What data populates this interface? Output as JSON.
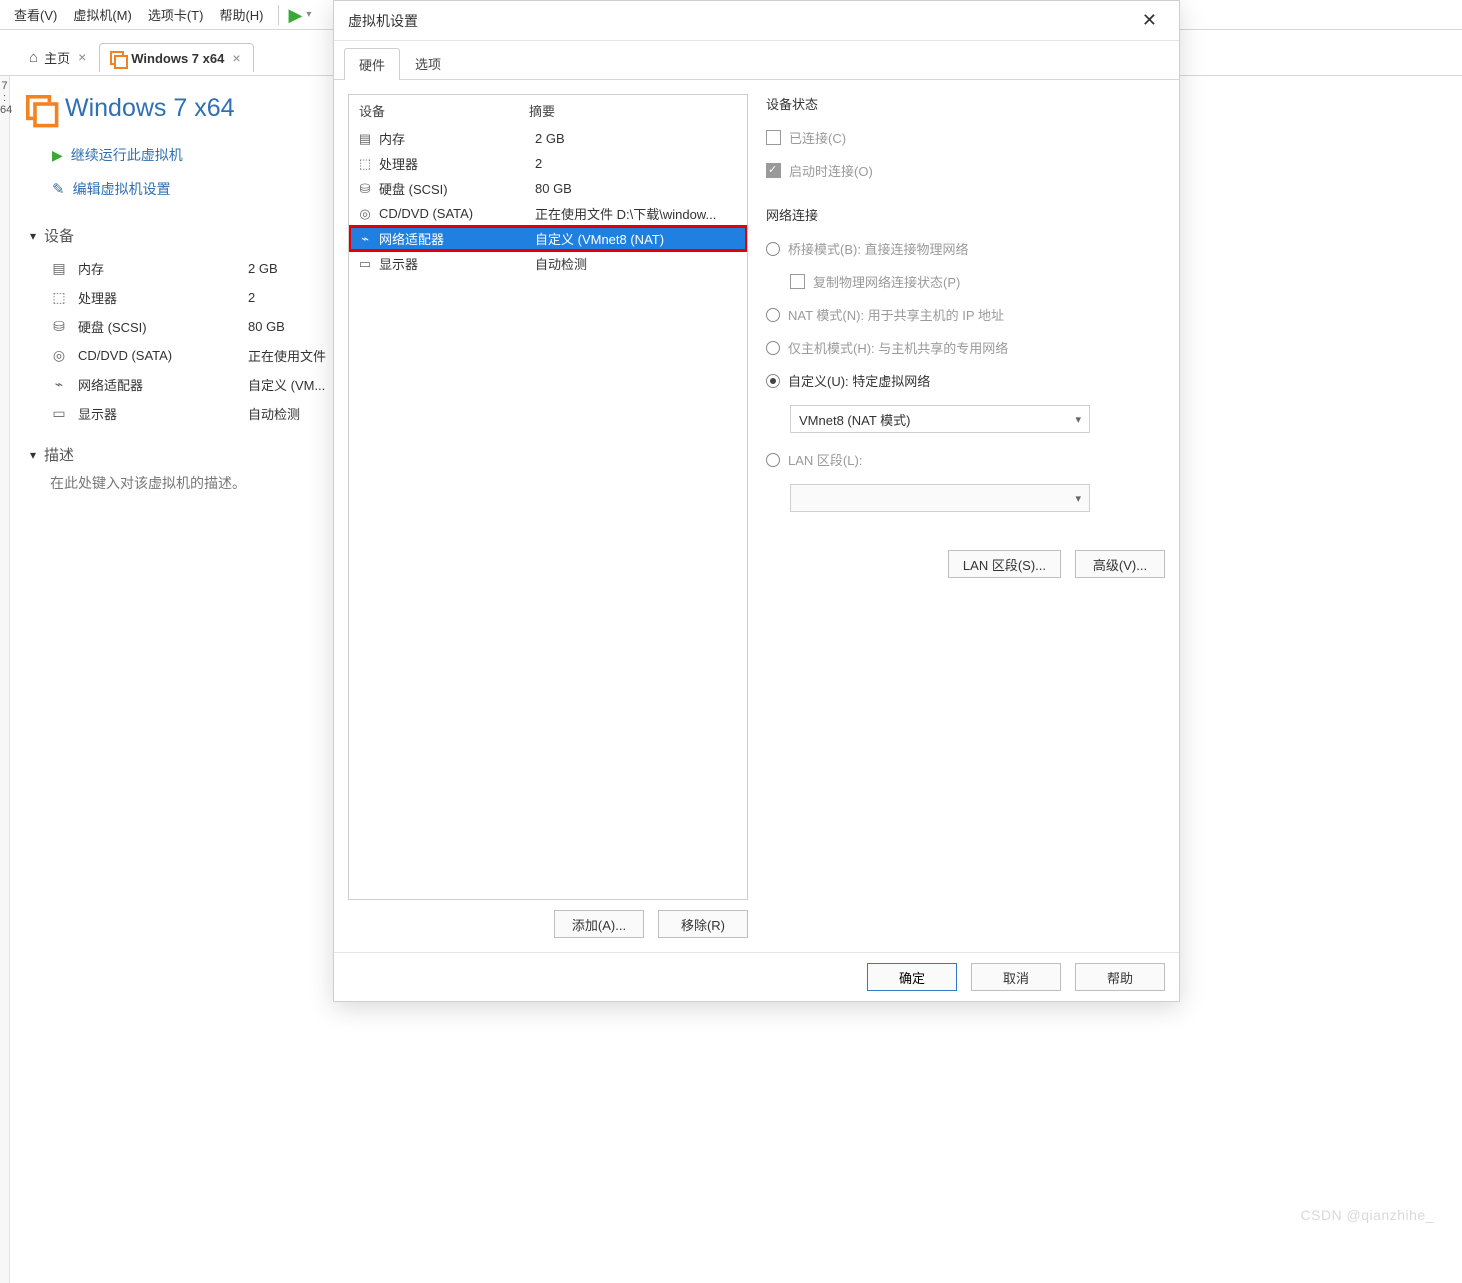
{
  "menu": {
    "view": "查看(V)",
    "vm": "虚拟机(M)",
    "tabs": "选项卡(T)",
    "help": "帮助(H)"
  },
  "tabs": {
    "home": "主页",
    "vm": "Windows 7 x64"
  },
  "sidebarHint": "7 :\n64",
  "vmTitle": "Windows 7 x64",
  "actions": {
    "run": "继续运行此虚拟机",
    "edit": "编辑虚拟机设置"
  },
  "sections": {
    "devices": "设备",
    "desc": "描述"
  },
  "descPlaceholder": "在此处键入对该虚拟机的描述。",
  "devList": [
    {
      "icon": "i-mem",
      "label": "内存",
      "value": "2 GB"
    },
    {
      "icon": "i-cpu",
      "label": "处理器",
      "value": "2"
    },
    {
      "icon": "i-hdd",
      "label": "硬盘 (SCSI)",
      "value": "80 GB"
    },
    {
      "icon": "i-cd",
      "label": "CD/DVD (SATA)",
      "value": "正在使用文件"
    },
    {
      "icon": "i-net",
      "label": "网络适配器",
      "value": "自定义 (VM..."
    },
    {
      "icon": "i-disp",
      "label": "显示器",
      "value": "自动检测"
    }
  ],
  "dialog": {
    "title": "虚拟机设置",
    "tabs": {
      "hw": "硬件",
      "opt": "选项"
    },
    "headers": {
      "device": "设备",
      "summary": "摘要"
    },
    "rows": [
      {
        "icon": "i-mem",
        "label": "内存",
        "value": "2 GB"
      },
      {
        "icon": "i-cpu",
        "label": "处理器",
        "value": "2"
      },
      {
        "icon": "i-hdd",
        "label": "硬盘 (SCSI)",
        "value": "80 GB"
      },
      {
        "icon": "i-cd",
        "label": "CD/DVD (SATA)",
        "value": "正在使用文件 D:\\下载\\window..."
      },
      {
        "icon": "i-net",
        "label": "网络适配器",
        "value": "自定义 (VMnet8 (NAT)"
      },
      {
        "icon": "i-disp",
        "label": "显示器",
        "value": "自动检测"
      }
    ],
    "addBtn": "添加(A)...",
    "removeBtn": "移除(R)",
    "right": {
      "status": "设备状态",
      "connected": "已连接(C)",
      "connectAtPower": "启动时连接(O)",
      "netTitle": "网络连接",
      "bridged": "桥接模式(B): 直接连接物理网络",
      "replicate": "复制物理网络连接状态(P)",
      "nat": "NAT 模式(N): 用于共享主机的 IP 地址",
      "host": "仅主机模式(H): 与主机共享的专用网络",
      "custom": "自定义(U): 特定虚拟网络",
      "customValue": "VMnet8 (NAT 模式)",
      "lan": "LAN 区段(L):",
      "lanBtn": "LAN 区段(S)...",
      "advBtn": "高级(V)..."
    },
    "footer": {
      "ok": "确定",
      "cancel": "取消",
      "help": "帮助"
    }
  },
  "watermark": "CSDN @qianzhihe_"
}
